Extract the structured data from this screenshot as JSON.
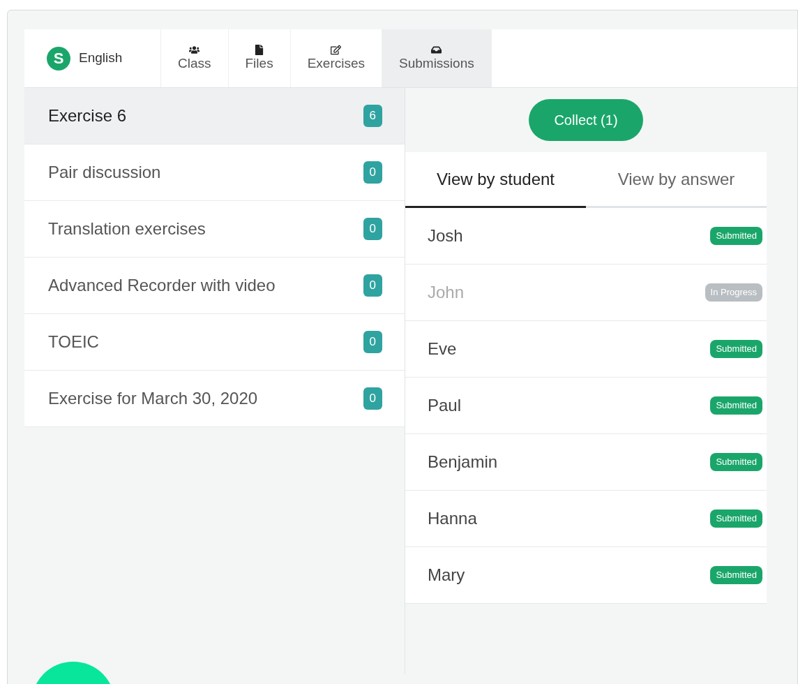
{
  "app": {
    "logo_letter": "S",
    "course": "English"
  },
  "tabs": [
    {
      "label": "Class",
      "selected": false
    },
    {
      "label": "Files",
      "selected": false
    },
    {
      "label": "Exercises",
      "selected": false
    },
    {
      "label": "Submissions",
      "selected": true
    }
  ],
  "exercises": [
    {
      "name": "Exercise 6",
      "count": "6",
      "selected": true
    },
    {
      "name": "Pair discussion",
      "count": "0",
      "selected": false
    },
    {
      "name": "Translation exercises",
      "count": "0",
      "selected": false
    },
    {
      "name": "Advanced Recorder with video",
      "count": "0",
      "selected": false
    },
    {
      "name": "TOEIC",
      "count": "0",
      "selected": false
    },
    {
      "name": "Exercise for March 30, 2020",
      "count": "0",
      "selected": false
    }
  ],
  "collect_button": "Collect (1)",
  "view_tabs": [
    {
      "label": "View by student",
      "selected": true
    },
    {
      "label": "View by answer",
      "selected": false
    }
  ],
  "students": [
    {
      "name": "Josh",
      "status": "Submitted",
      "kind": "submitted"
    },
    {
      "name": "John",
      "status": "In Progress",
      "kind": "in_progress"
    },
    {
      "name": "Eve",
      "status": "Submitted",
      "kind": "submitted"
    },
    {
      "name": "Paul",
      "status": "Submitted",
      "kind": "submitted"
    },
    {
      "name": "Benjamin",
      "status": "Submitted",
      "kind": "submitted"
    },
    {
      "name": "Hanna",
      "status": "Submitted",
      "kind": "submitted"
    },
    {
      "name": "Mary",
      "status": "Submitted",
      "kind": "submitted"
    }
  ]
}
